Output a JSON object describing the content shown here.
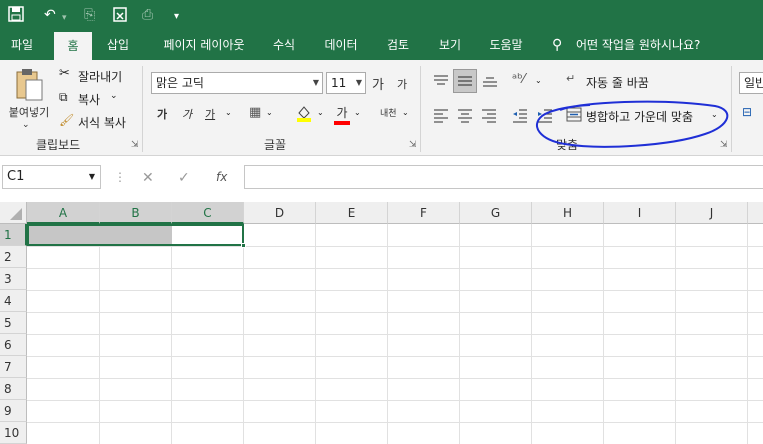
{
  "qat": {
    "icons": [
      "save-icon",
      "undo-icon",
      "redo-icon",
      "clipboard-icon",
      "format-painter-icon",
      "customize-icon"
    ]
  },
  "tabs": [
    {
      "label": "파일",
      "active": false
    },
    {
      "label": "홈",
      "active": true
    },
    {
      "label": "삽입",
      "active": false
    },
    {
      "label": "페이지 레이아웃",
      "active": false
    },
    {
      "label": "수식",
      "active": false
    },
    {
      "label": "데이터",
      "active": false
    },
    {
      "label": "검토",
      "active": false
    },
    {
      "label": "보기",
      "active": false
    },
    {
      "label": "도움말",
      "active": false
    }
  ],
  "tell_me": "어떤 작업을 원하시나요?",
  "clipboard": {
    "paste": "붙여넣기",
    "cut": "잘라내기",
    "copy": "복사",
    "format_painter": "서식 복사",
    "group": "클립보드"
  },
  "font": {
    "name": "맑은 고딕",
    "size": "11",
    "grow": "가",
    "shrink": "가",
    "bold": "가",
    "italic": "가",
    "underline": "가",
    "font_color": "가",
    "phonetic": "내천",
    "group": "글꼴",
    "fill_color": "#ffff00",
    "text_color": "#ff0000"
  },
  "alignment": {
    "wrap": "자동 줄 바꿈",
    "merge": "병합하고 가운데 맞춤",
    "group": "맞춤"
  },
  "number": {
    "format": "일반"
  },
  "formula_bar": {
    "cell_ref": "C1",
    "fx": "fx",
    "content": ""
  },
  "columns": [
    "A",
    "B",
    "C",
    "D",
    "E",
    "F",
    "G",
    "H",
    "I",
    "J"
  ],
  "rows": [
    "1",
    "2",
    "3",
    "4",
    "5",
    "6",
    "7",
    "8",
    "9",
    "10"
  ],
  "selected_cell": "C1",
  "theme": {
    "accent": "#217346",
    "annotation": "#1f2fd6"
  }
}
